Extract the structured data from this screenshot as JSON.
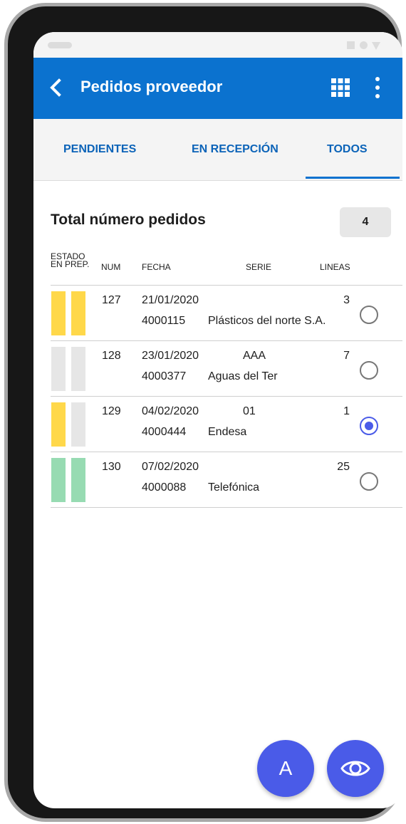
{
  "app": {
    "title": "Pedidos proveedor"
  },
  "icons": {
    "back": "chevron-left-icon",
    "apps": "grid-icon",
    "more": "more-vert-icon",
    "view": "eye-icon"
  },
  "tabs": [
    {
      "label": "PENDIENTES",
      "selected": false
    },
    {
      "label": "EN RECEPCIÓN",
      "selected": false
    },
    {
      "label": "TODOS",
      "selected": true
    }
  ],
  "summary": {
    "label": "Total número pedidos",
    "value": "4"
  },
  "columns": {
    "estado_1": "ESTADO",
    "estado_2": "EN PREP.",
    "num": "NUM",
    "fecha": "FECHA",
    "serie": "SERIE",
    "lineas": "LINEAS"
  },
  "colors": {
    "primary": "#0b72cf",
    "accent": "#4a5be8",
    "yellow": "#ffd84a",
    "gray": "#e6e6e6",
    "green": "#97dbb2"
  },
  "orders": [
    {
      "num": "127",
      "fecha": "21/01/2020",
      "serie": "",
      "lineas": "3",
      "code": "4000115",
      "proveedor": "Plásticos del norte S.A.",
      "estado": "yellow",
      "en_prep": "yellow",
      "selected": false
    },
    {
      "num": "128",
      "fecha": "23/01/2020",
      "serie": "AAA",
      "lineas": "7",
      "code": "4000377",
      "proveedor": "Aguas del Ter",
      "estado": "gray",
      "en_prep": "gray",
      "selected": false
    },
    {
      "num": "129",
      "fecha": "04/02/2020",
      "serie": "01",
      "lineas": "1",
      "code": "4000444",
      "proveedor": "Endesa",
      "estado": "yellow",
      "en_prep": "gray",
      "selected": true
    },
    {
      "num": "130",
      "fecha": "07/02/2020",
      "serie": "",
      "lineas": "25",
      "code": "4000088",
      "proveedor": "Telefónica",
      "estado": "green",
      "en_prep": "green",
      "selected": false
    }
  ],
  "actions": {
    "a_label": "A"
  }
}
